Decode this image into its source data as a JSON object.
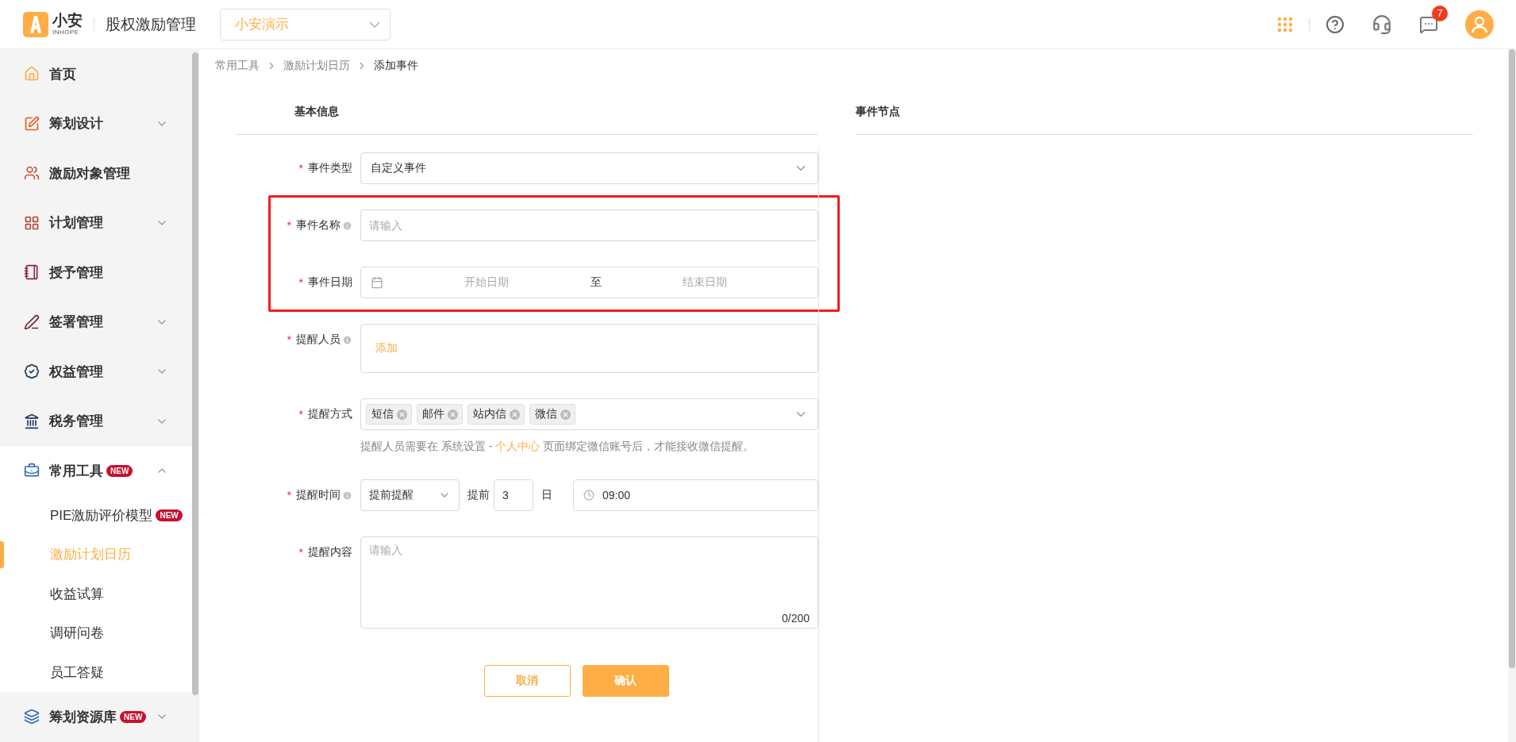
{
  "header": {
    "logo_text": "小安",
    "logo_subtext": "INHOPE",
    "app_title": "股权激励管理",
    "org_select": {
      "value": "小安演示"
    },
    "message_count": "7"
  },
  "sidebar": {
    "items": [
      {
        "label": "首页",
        "kind": "link"
      },
      {
        "label": "筹划设计",
        "kind": "group",
        "expanded": false
      },
      {
        "label": "激励对象管理",
        "kind": "link"
      },
      {
        "label": "计划管理",
        "kind": "group",
        "expanded": false
      },
      {
        "label": "授予管理",
        "kind": "link"
      },
      {
        "label": "签署管理",
        "kind": "group",
        "expanded": false
      },
      {
        "label": "权益管理",
        "kind": "group",
        "expanded": false
      },
      {
        "label": "税务管理",
        "kind": "group",
        "expanded": false
      },
      {
        "label": "常用工具",
        "kind": "group",
        "expanded": true,
        "badge": "NEW",
        "children": [
          {
            "label": "PIE激励评价模型",
            "badge": "NEW",
            "selected": false
          },
          {
            "label": "激励计划日历",
            "selected": true
          },
          {
            "label": "收益试算",
            "selected": false
          },
          {
            "label": "调研问卷",
            "selected": false
          },
          {
            "label": "员工答疑",
            "selected": false
          }
        ]
      },
      {
        "label": "筹划资源库",
        "kind": "group",
        "expanded": false,
        "badge": "NEW"
      }
    ]
  },
  "breadcrumb": [
    "常用工具",
    "激励计划日历",
    "添加事件"
  ],
  "form": {
    "title": "基本信息",
    "fields": [
      {
        "kind": "select",
        "label": "事件类型",
        "required_mark": "*",
        "info": false,
        "highlighted": false,
        "value": "自定义事件"
      },
      {
        "kind": "input",
        "label": "事件名称",
        "required_mark": "*",
        "info": true,
        "highlighted": true,
        "placeholder": "请输入"
      },
      {
        "kind": "daterange",
        "label": "事件日期",
        "required_mark": "*",
        "info": false,
        "highlighted": true,
        "start_placeholder": "开始日期",
        "separator": "至",
        "end_placeholder": "结束日期"
      },
      {
        "kind": "adder",
        "label": "提醒人员",
        "required_mark": "*",
        "info": true,
        "highlighted": false,
        "action": "添加"
      },
      {
        "kind": "tags",
        "label": "提醒方式",
        "required_mark": "*",
        "info": false,
        "highlighted": false,
        "tags": [
          "短信",
          "邮件",
          "站内信",
          "微信"
        ],
        "hint_before": "提醒人员需要在 系统设置 - ",
        "hint_link": "个人中心",
        "hint_after": " 页面绑定微信账号后，才能接收微信提醒。"
      },
      {
        "kind": "reminder",
        "label": "提醒时间",
        "required_mark": "*",
        "info": true,
        "highlighted": false,
        "mode": "提前提醒",
        "prefix": "提前",
        "days": "3",
        "unit": "日",
        "time": "09:00"
      },
      {
        "kind": "textarea",
        "label": "提醒内容",
        "required_mark": "*",
        "info": false,
        "highlighted": false,
        "placeholder": "请输入",
        "counter": "0/200"
      }
    ],
    "buttons": [
      {
        "label": "取消",
        "kind": "secondary"
      },
      {
        "label": "确认",
        "kind": "primary"
      }
    ]
  },
  "side_panel": {
    "title": "事件节点"
  }
}
